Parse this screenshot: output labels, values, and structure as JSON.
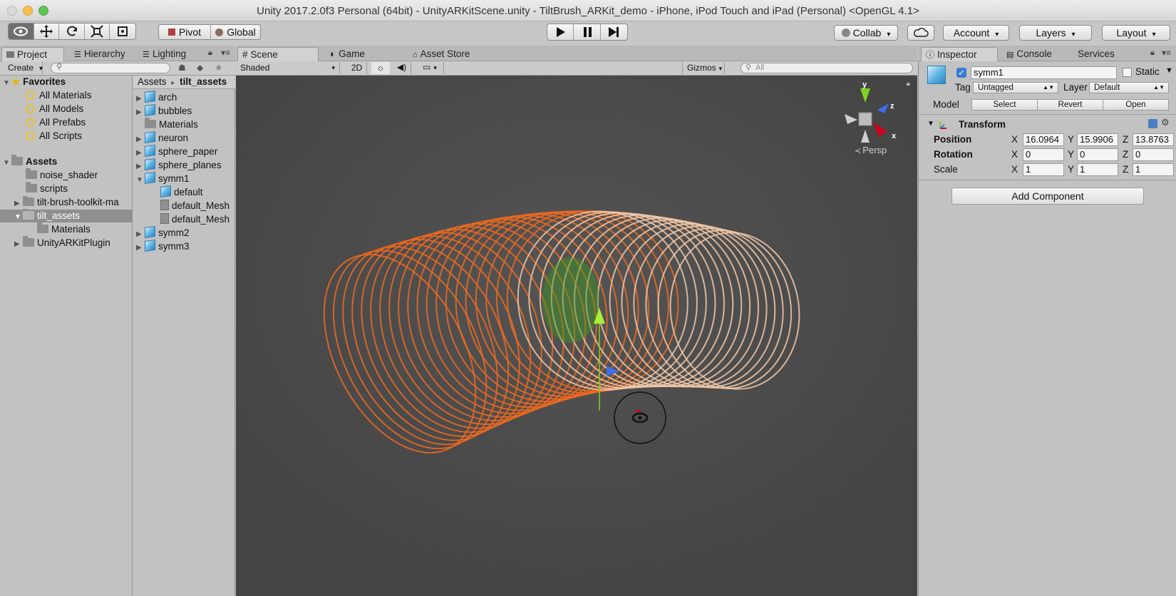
{
  "window": {
    "title": "Unity 2017.2.0f3 Personal (64bit) - UnityARKitScene.unity - TiltBrush_ARKit_demo - iPhone, iPod Touch and iPad (Personal) <OpenGL 4.1>"
  },
  "toolbar": {
    "pivot": "Pivot",
    "global": "Global",
    "collab": "Collab",
    "account": "Account",
    "layers": "Layers",
    "layout": "Layout"
  },
  "left_tabs": {
    "project": "Project",
    "hierarchy": "Hierarchy",
    "lighting": "Lighting"
  },
  "project": {
    "create": "Create",
    "favorites_label": "Favorites",
    "favorites": [
      "All Materials",
      "All Models",
      "All Prefabs",
      "All Scripts"
    ],
    "assets_label": "Assets",
    "assets": [
      "noise_shader",
      "scripts",
      "tilt-brush-toolkit-ma",
      "tilt_assets",
      "Materials",
      "UnityARKitPlugin"
    ]
  },
  "breadcrumb": {
    "root": "Assets",
    "sep": "▸",
    "current": "tilt_assets"
  },
  "files": [
    "arch",
    "bubbles",
    "Materials",
    "neuron",
    "sphere_paper",
    "sphere_planes",
    "symm1",
    "default",
    "default_Mesh",
    "default_Mesh",
    "symm2",
    "symm3"
  ],
  "scene_tabs": {
    "scene": "Scene",
    "game": "Game",
    "store": "Asset Store"
  },
  "scene_bar": {
    "shading": "Shaded",
    "mode_2d": "2D",
    "gizmos": "Gizmos",
    "search_placeholder": "All"
  },
  "gizmo": {
    "y": "y",
    "z": "z",
    "x": "x",
    "persp": "Persp"
  },
  "right_tabs": {
    "inspector": "Inspector",
    "console": "Console",
    "services": "Services"
  },
  "inspector": {
    "name": "symm1",
    "static": "Static",
    "tag_label": "Tag",
    "tag_value": "Untagged",
    "layer_label": "Layer",
    "layer_value": "Default",
    "model_label": "Model",
    "select": "Select",
    "revert": "Revert",
    "open": "Open",
    "component": "Transform",
    "position_label": "Position",
    "rotation_label": "Rotation",
    "scale_label": "Scale",
    "axis_x": "X",
    "axis_y": "Y",
    "axis_z": "Z",
    "position": {
      "x": "16.0964",
      "y": "15.9906",
      "z": "13.8763"
    },
    "rotation": {
      "x": "0",
      "y": "0",
      "z": "0"
    },
    "scale": {
      "x": "1",
      "y": "1",
      "z": "1"
    },
    "add_component": "Add Component"
  },
  "colors": {
    "stroke_orange": "#f06a1e",
    "scene_bg": "#474747",
    "gizmo_y": "#7ed321",
    "gizmo_z": "#3b6ee8",
    "gizmo_x": "#d0021b"
  }
}
